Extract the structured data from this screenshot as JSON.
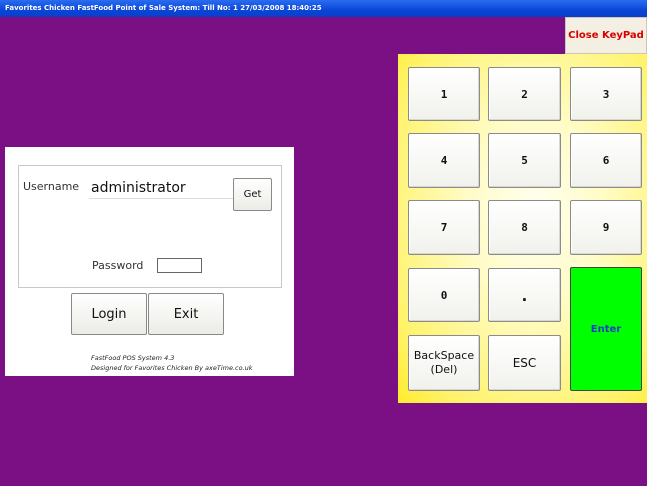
{
  "window": {
    "title": "Favorites Chicken FastFood Point of Sale System:  Till No: 1  27/03/2008 18:40:25"
  },
  "keypad": {
    "close_label": "Close KeyPad",
    "keys": [
      "1",
      "2",
      "3",
      "4",
      "5",
      "6",
      "7",
      "8",
      "9",
      "0",
      "."
    ],
    "backspace_line1": "BackSpace",
    "backspace_line2": "(Del)",
    "esc_label": "ESC",
    "enter_label": "Enter"
  },
  "login": {
    "username_label": "Username",
    "username_value": "administrator",
    "get_label": "Get",
    "password_label": "Password",
    "password_value": "",
    "login_label": "Login",
    "exit_label": "Exit",
    "footer_line1": "FastFood POS System 4.3",
    "footer_line2": "Designed for Favorites Chicken By axeTime.co.uk"
  },
  "colors": {
    "background": "#7b0f84",
    "keypad_bg": "#fff36b",
    "enter_bg": "#00ff00",
    "close_text": "#d80000"
  }
}
